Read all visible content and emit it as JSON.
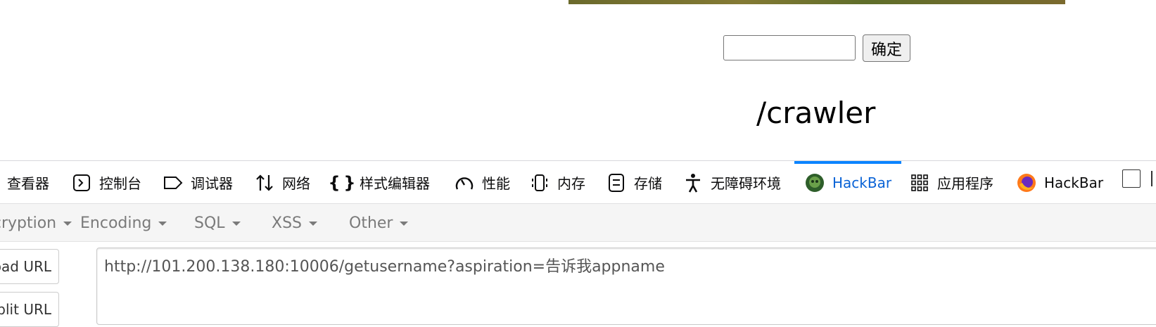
{
  "page": {
    "submit_label": "确定",
    "heading": "/crawler",
    "input_value": ""
  },
  "devtools": {
    "tabs": [
      {
        "label": "查看器",
        "icon": "inspector-icon"
      },
      {
        "label": "控制台",
        "icon": "console-icon"
      },
      {
        "label": "调试器",
        "icon": "debugger-icon"
      },
      {
        "label": "网络",
        "icon": "network-icon"
      },
      {
        "label": "样式编辑器",
        "icon": "style-editor-icon"
      },
      {
        "label": "性能",
        "icon": "performance-icon"
      },
      {
        "label": "内存",
        "icon": "memory-icon"
      },
      {
        "label": "存储",
        "icon": "storage-icon"
      },
      {
        "label": "无障碍环境",
        "icon": "accessibility-icon"
      },
      {
        "label": "HackBar",
        "icon": "hackbar-green-icon",
        "active": true
      },
      {
        "label": "应用程序",
        "icon": "application-grid-icon"
      },
      {
        "label": "HackBar",
        "icon": "firefox-hackbar-icon"
      }
    ],
    "accent_color": "#0a84ff"
  },
  "hackbar": {
    "menu": {
      "encryption": "Encryption",
      "encoding": "Encoding",
      "sql": "SQL",
      "xss": "XSS",
      "other": "Other"
    },
    "buttons": {
      "load_url": "Load URL",
      "split_url": "Split URL"
    },
    "url_value": "http://101.200.138.180:10006/getusername?aspiration=告诉我appname"
  }
}
